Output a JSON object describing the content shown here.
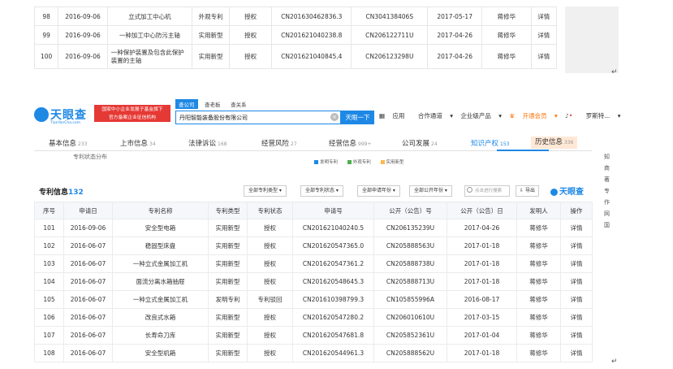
{
  "top_rows": [
    {
      "no": "98",
      "date": "2016-09-06",
      "name": "立式加工中心机",
      "type": "外观专利",
      "status": "授权",
      "app_no": "CN201630462836.3",
      "pub_no": "CN304138406S",
      "pub_date": "2017-05-17",
      "inventor": "蒋修华",
      "action": "详情"
    },
    {
      "no": "99",
      "date": "2016-09-06",
      "name": "一种加工中心防污主轴",
      "type": "实用新型",
      "status": "授权",
      "app_no": "CN201621040238.8",
      "pub_no": "CN206122711U",
      "pub_date": "2017-04-26",
      "inventor": "蒋修华",
      "action": "详情"
    },
    {
      "no": "100",
      "date": "2016-09-06",
      "name": "一种保护装置及包含此保护装置的主轴",
      "type": "实用新型",
      "status": "授权",
      "app_no": "CN201621040845.4",
      "pub_no": "CN206123298U",
      "pub_date": "2017-04-26",
      "inventor": "蒋修华",
      "action": "详情"
    }
  ],
  "para_mark": "↵",
  "header": {
    "logo_text": "天眼查",
    "logo_url": "TianYanCha.com",
    "promo_line1": "国家中小企业发展子基金旗下",
    "promo_line2": "官方备案企业征信机构",
    "search_tabs": [
      "查公司",
      "查老板",
      "查关系"
    ],
    "search_value": "丹阳智能装备股份有限公司",
    "search_button": "天眼一下",
    "nav": {
      "app": "应用",
      "cooperation": "合作通道",
      "enterprise": "企业级产品",
      "vip": "开通会员",
      "user": "罗斯特..."
    }
  },
  "tabs": [
    {
      "label": "基本信息",
      "count": "233"
    },
    {
      "label": "上市信息",
      "count": "34"
    },
    {
      "label": "法律诉讼",
      "count": "168"
    },
    {
      "label": "经营风险",
      "count": "27"
    },
    {
      "label": "经营信息",
      "count": "999+"
    },
    {
      "label": "公司发展",
      "count": "24"
    },
    {
      "label": "知识产权",
      "count": "153"
    },
    {
      "label": "历史信息",
      "count": "336"
    }
  ],
  "chart": {
    "title": "专利状态分布",
    "legend": [
      {
        "label": "发明专利",
        "color": "#1e88e5"
      },
      {
        "label": "外观专利",
        "color": "#4caf50"
      },
      {
        "label": "实用新型",
        "color": "#ffb74d"
      }
    ]
  },
  "toolbar": {
    "title": "专利信息",
    "count": "132",
    "filters": [
      "全部专利类型",
      "全部专利状态",
      "全部申请年份",
      "全部公开年份"
    ],
    "search_placeholder": "点击进行搜索",
    "export": "导出",
    "watermark": "天眼查"
  },
  "table": {
    "headers": [
      "序号",
      "申请日",
      "专利名称",
      "专利类型",
      "专利状态",
      "申请号",
      "公开（公告）号",
      "公开（公告）日",
      "发明人",
      "操作"
    ],
    "rows": [
      {
        "no": "101",
        "date": "2016-09-06",
        "name": "安全型电箱",
        "type": "实用新型",
        "status": "授权",
        "app_no": "CN201621040240.5",
        "pub_no": "CN206135239U",
        "pub_date": "2017-04-26",
        "inventor": "蒋修华",
        "action": "详情"
      },
      {
        "no": "102",
        "date": "2016-06-07",
        "name": "稳固型床盘",
        "type": "实用新型",
        "status": "授权",
        "app_no": "CN201620547365.0",
        "pub_no": "CN205888563U",
        "pub_date": "2017-01-18",
        "inventor": "蒋修华",
        "action": "详情"
      },
      {
        "no": "103",
        "date": "2016-06-07",
        "name": "一种立式金属加工机",
        "type": "实用新型",
        "status": "授权",
        "app_no": "CN201620547361.2",
        "pub_no": "CN205888738U",
        "pub_date": "2017-01-18",
        "inventor": "蒋修华",
        "action": "详情"
      },
      {
        "no": "104",
        "date": "2016-06-07",
        "name": "面流分离水箱抽屉",
        "type": "实用新型",
        "status": "授权",
        "app_no": "CN201620548645.3",
        "pub_no": "CN205888713U",
        "pub_date": "2017-01-18",
        "inventor": "蒋修华",
        "action": "详情"
      },
      {
        "no": "105",
        "date": "2016-06-07",
        "name": "一种立式金属加工机",
        "type": "发明专利",
        "status": "专利驳回",
        "app_no": "CN201610398799.3",
        "pub_no": "CN105855996A",
        "pub_date": "2016-08-17",
        "inventor": "蒋修华",
        "action": "详情"
      },
      {
        "no": "106",
        "date": "2016-06-07",
        "name": "改良式水箱",
        "type": "实用新型",
        "status": "授权",
        "app_no": "CN201620547280.2",
        "pub_no": "CN206010610U",
        "pub_date": "2017-03-15",
        "inventor": "蒋修华",
        "action": "详情"
      },
      {
        "no": "107",
        "date": "2016-06-07",
        "name": "长寿命刀库",
        "type": "实用新型",
        "status": "授权",
        "app_no": "CN201620547681.8",
        "pub_no": "CN205852361U",
        "pub_date": "2017-01-04",
        "inventor": "蒋修华",
        "action": "详情"
      },
      {
        "no": "108",
        "date": "2016-06-07",
        "name": "安全型机箱",
        "type": "实用新型",
        "status": "授权",
        "app_no": "CN201620544961.3",
        "pub_no": "CN205888562U",
        "pub_date": "2017-01-18",
        "inventor": "蒋修华",
        "action": "详情"
      }
    ]
  },
  "sidebar": [
    "知",
    "商",
    "著",
    "专",
    "作",
    "网",
    "国"
  ]
}
